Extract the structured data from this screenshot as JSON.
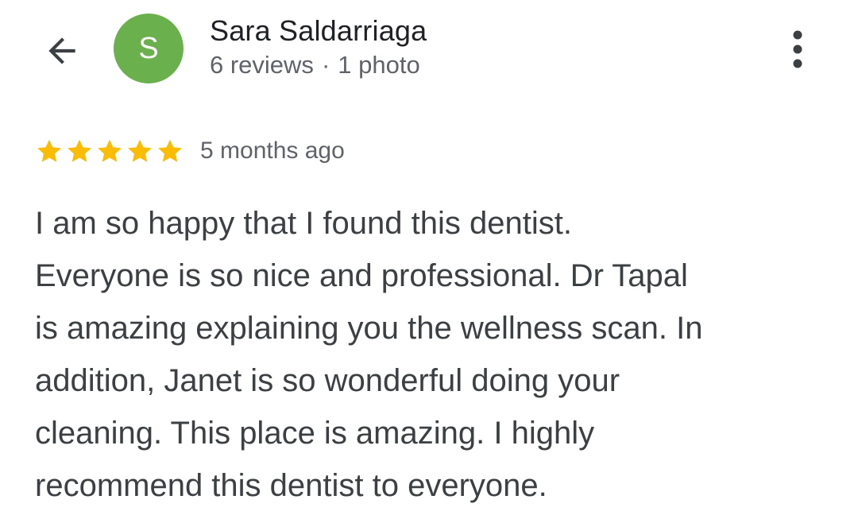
{
  "header": {
    "back_icon": "arrow-left-icon",
    "avatar_initial": "S",
    "avatar_color": "#6ab04c",
    "reviewer_name": "Sara Saldarriaga",
    "reviews_count": "6 reviews",
    "separator": "·",
    "photos_count": "1 photo",
    "more_icon": "more-vert-icon"
  },
  "review": {
    "rating": 5,
    "rating_max": 5,
    "star_color": "#fbbc04",
    "time": "5 months ago",
    "text_lines": [
      "I am so happy that I found this dentist.",
      "Everyone is so nice and professional. Dr Tapal",
      "is amazing explaining you the wellness scan. In",
      "addition, Janet is so wonderful doing your",
      "cleaning. This place is amazing. I highly",
      "recommend this dentist to everyone."
    ]
  }
}
